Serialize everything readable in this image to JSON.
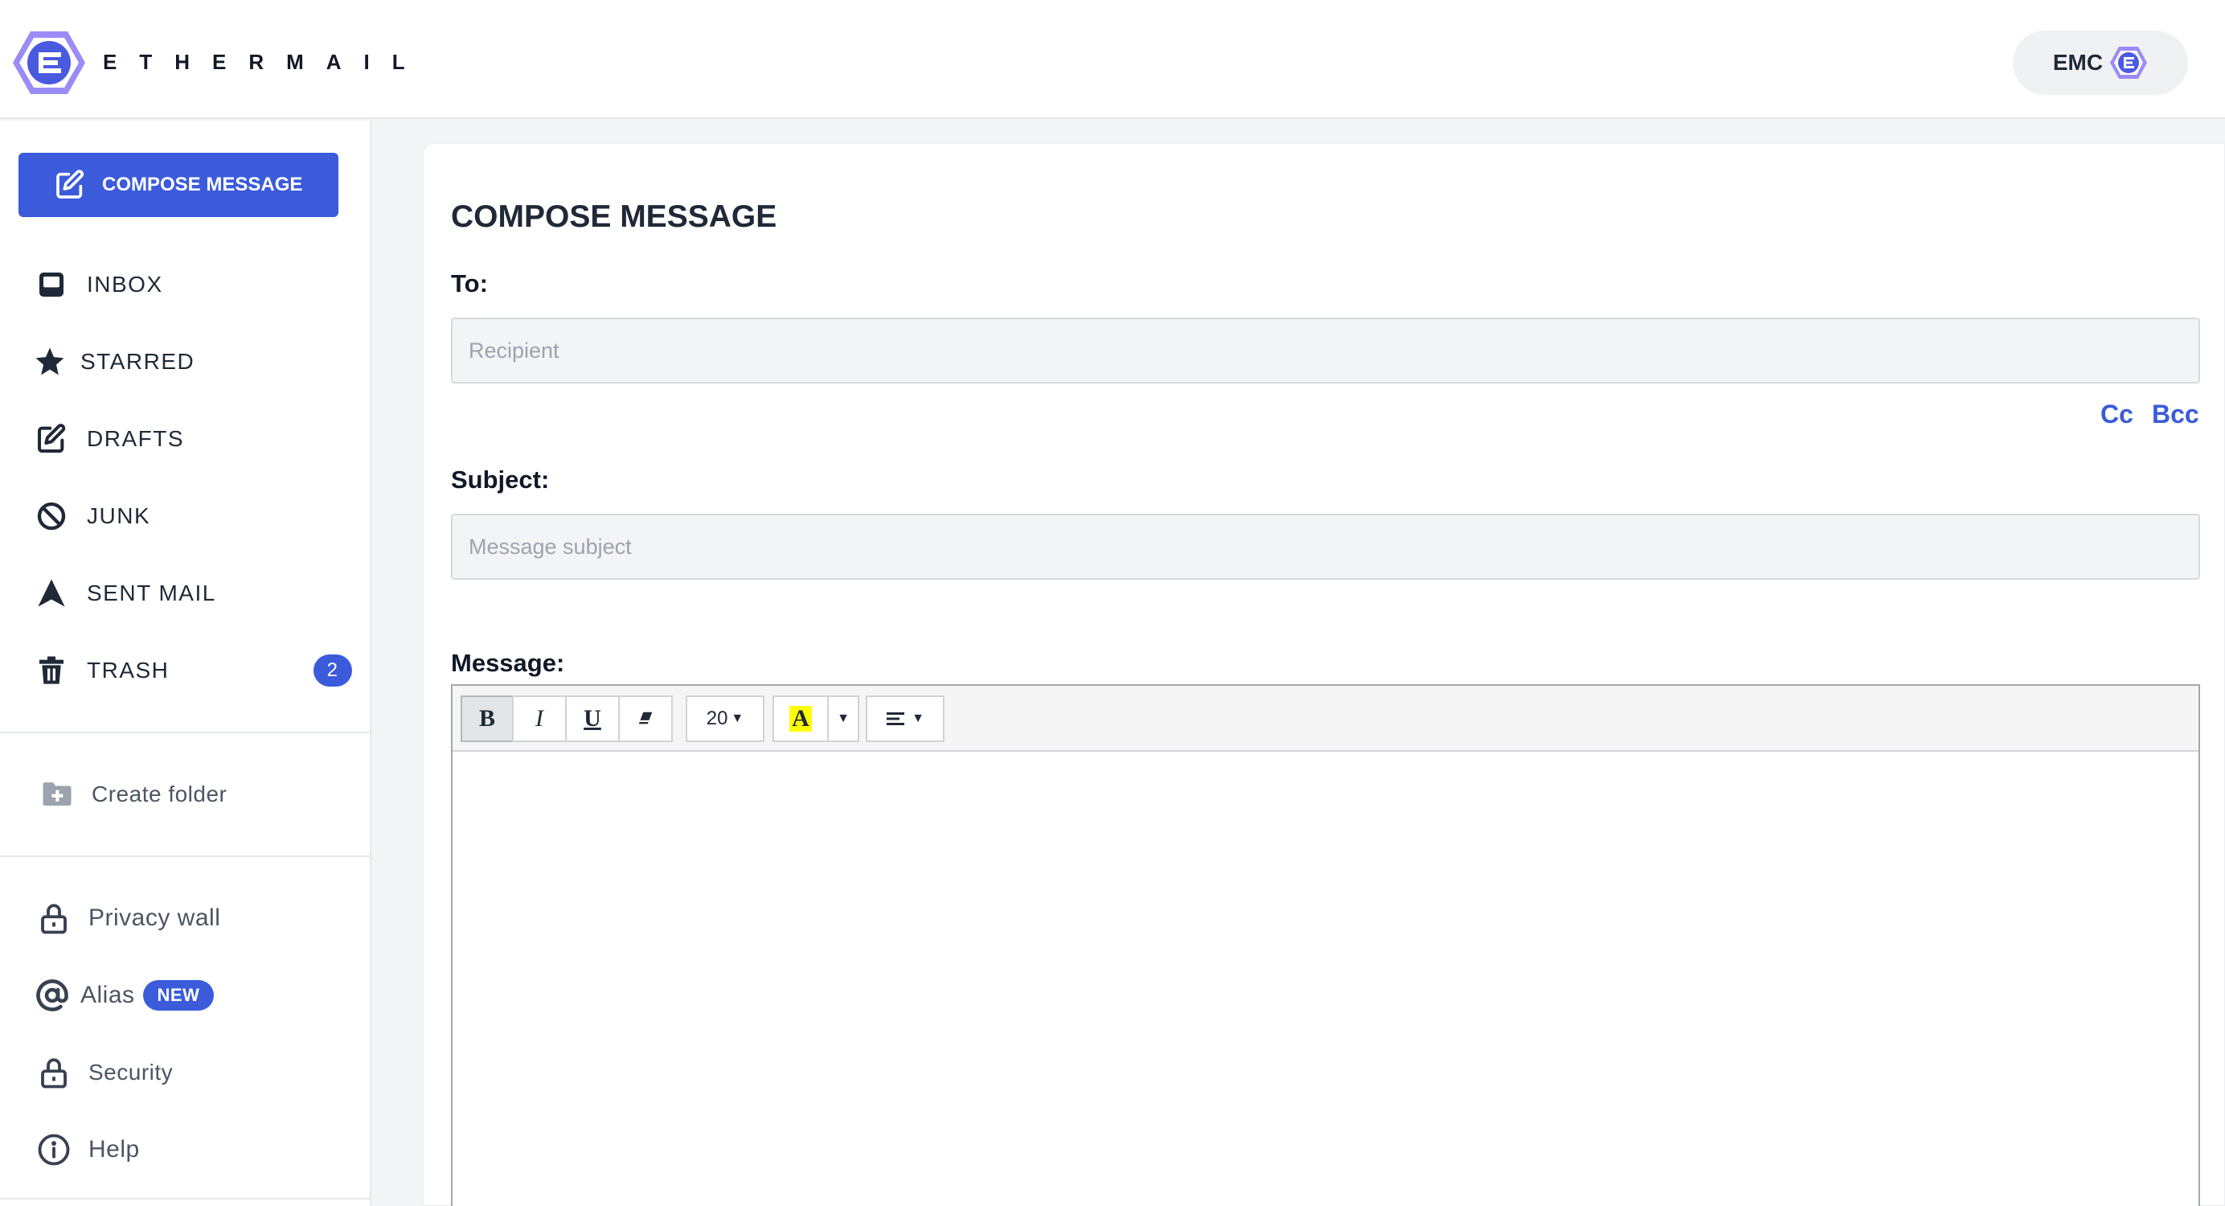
{
  "header": {
    "brand": "ETHERMAIL",
    "token_label": "EMC"
  },
  "colors": {
    "accent": "#3b5bdb",
    "logo_purple": "#8b7cf0",
    "highlight": "#ffff00"
  },
  "sidebar": {
    "compose_label": "COMPOSE MESSAGE",
    "folders": [
      {
        "label": "INBOX",
        "icon": "inbox-icon"
      },
      {
        "label": "STARRED",
        "icon": "star-icon"
      },
      {
        "label": "DRAFTS",
        "icon": "edit-icon"
      },
      {
        "label": "JUNK",
        "icon": "ban-icon"
      },
      {
        "label": "SENT MAIL",
        "icon": "sent-icon"
      },
      {
        "label": "TRASH",
        "icon": "trash-icon",
        "badge": "2"
      }
    ],
    "create_folder": "Create folder",
    "secondary": [
      {
        "label": "Privacy wall",
        "icon": "lock-icon"
      },
      {
        "label": "Alias",
        "icon": "at-icon",
        "badge": "NEW"
      },
      {
        "label": "Security",
        "icon": "lock-icon"
      },
      {
        "label": "Help",
        "icon": "info-icon"
      }
    ]
  },
  "compose": {
    "title": "COMPOSE MESSAGE",
    "to_label": "To:",
    "to_placeholder": "Recipient",
    "cc_label": "Cc",
    "bcc_label": "Bcc",
    "subject_label": "Subject:",
    "subject_placeholder": "Message subject",
    "message_label": "Message:"
  },
  "toolbar": {
    "bold": "B",
    "italic": "I",
    "underline": "U",
    "font_size": "20",
    "color_letter": "A"
  }
}
